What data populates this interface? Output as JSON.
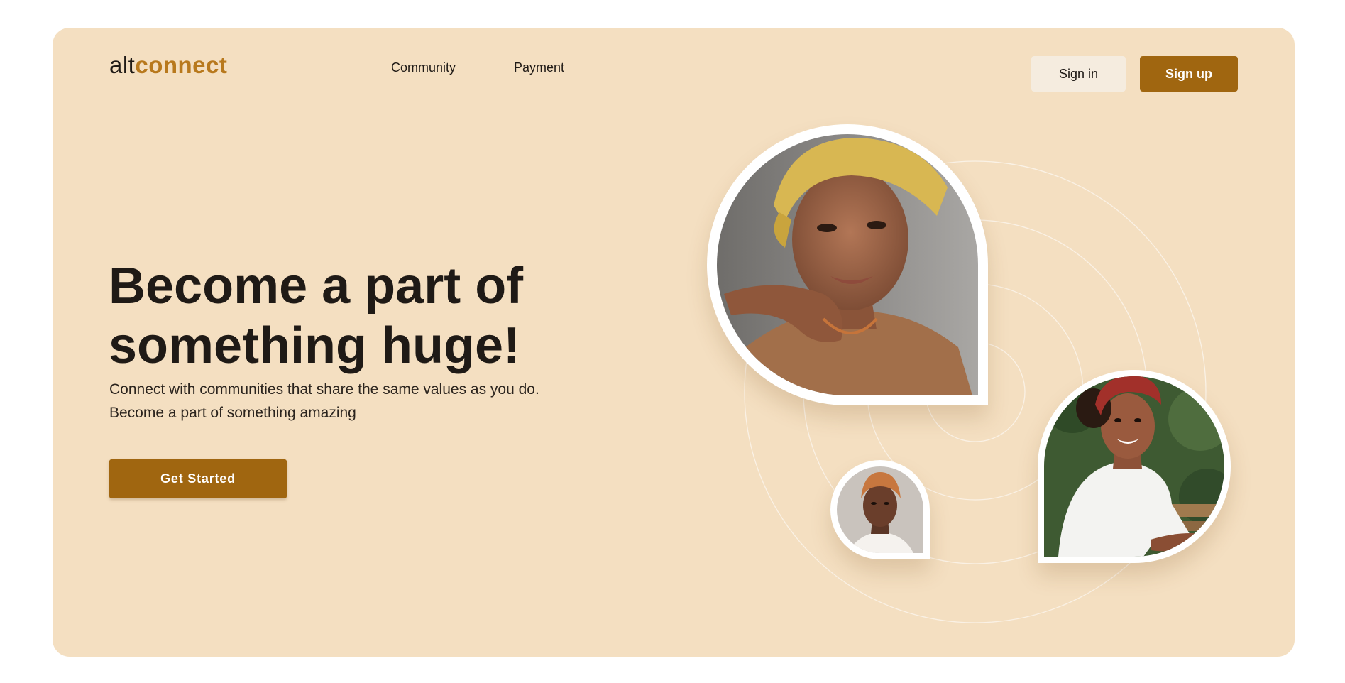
{
  "brand": {
    "prefix": "alt",
    "accent": "connect"
  },
  "nav": {
    "items": [
      "Community",
      "Payment"
    ]
  },
  "auth": {
    "signin_label": "Sign in",
    "signup_label": "Sign up"
  },
  "hero": {
    "headline_line1": "Become a part of",
    "headline_line2": "something huge!",
    "subtext_line1": "Connect with communities that share the same values as you do.",
    "subtext_line2": "Become a part of something amazing",
    "cta_label": "Get Started"
  },
  "colors": {
    "background": "#f4dfc1",
    "accent": "#a06610",
    "logo_accent": "#b8791d",
    "text": "#1f1a16"
  }
}
